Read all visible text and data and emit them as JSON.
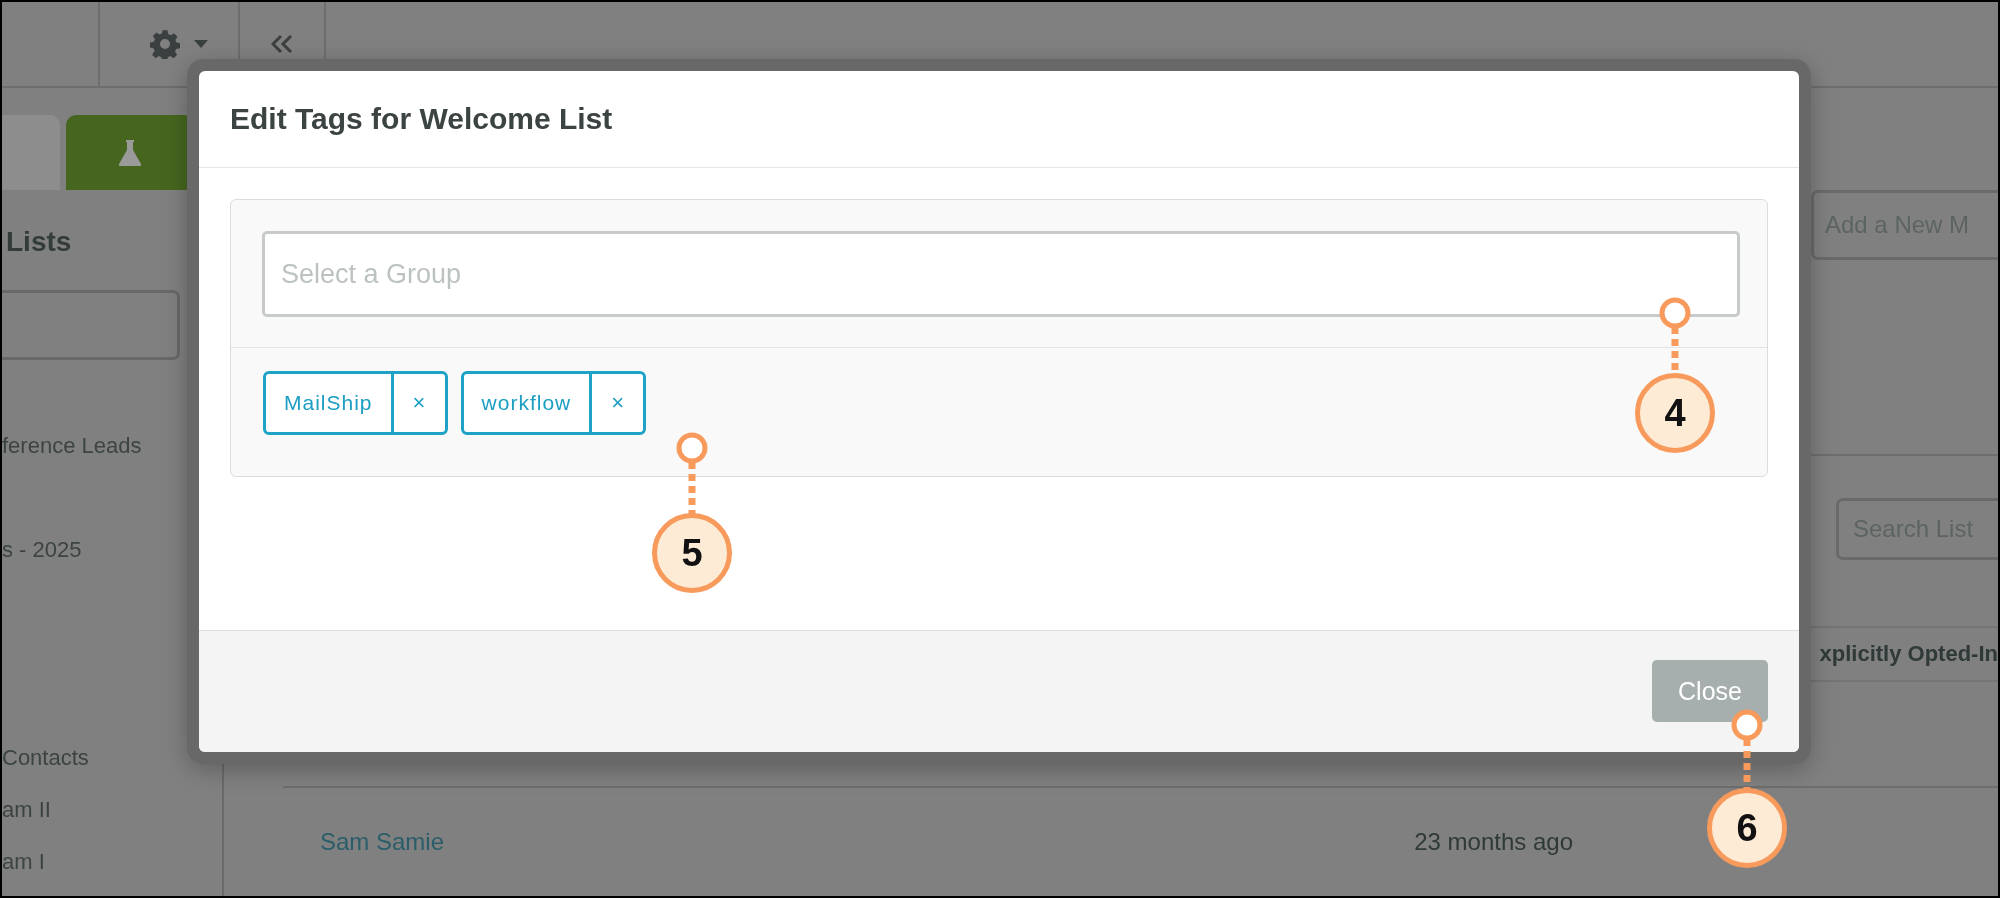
{
  "sidebar": {
    "tabs": [
      {
        "selected": true
      },
      {
        "selected": false
      }
    ],
    "heading": "Lists",
    "items": [
      "ference Leads",
      "s - 2025",
      "Contacts",
      "am II",
      "am I"
    ]
  },
  "main": {
    "add_button": "Add a New M",
    "search": {
      "placeholder": "Search List"
    },
    "table": {
      "column_header": "xplicitly Opted-In",
      "rows": [
        {
          "name": "Sam Samie",
          "time": "23 months ago"
        }
      ]
    }
  },
  "modal": {
    "title": "Edit Tags for Welcome List",
    "group_select": {
      "placeholder": "Select a Group"
    },
    "tags": [
      {
        "label": "MailShip",
        "remove": "×"
      },
      {
        "label": "workflow",
        "remove": "×"
      }
    ],
    "close_button": "Close"
  },
  "callouts": [
    {
      "label": "4"
    },
    {
      "label": "5"
    },
    {
      "label": "6"
    }
  ]
}
